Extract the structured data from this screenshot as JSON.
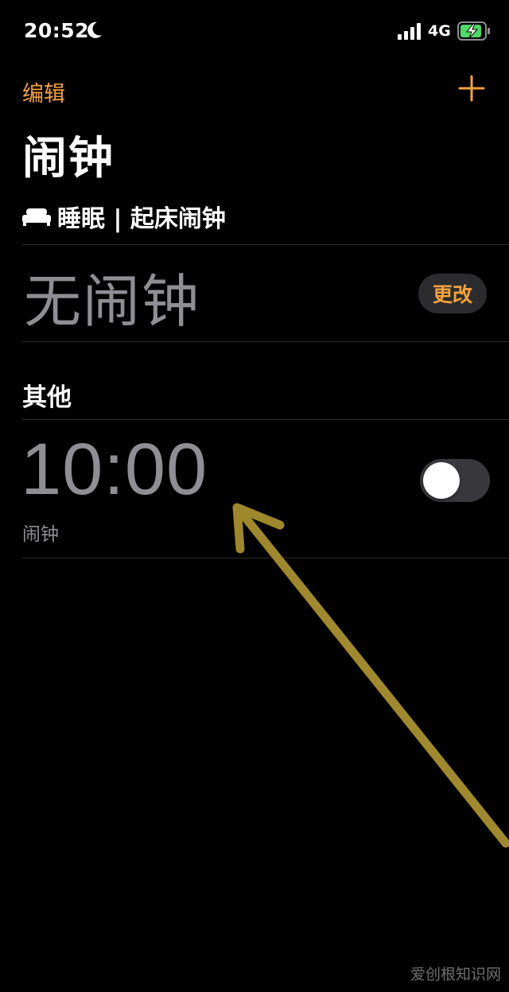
{
  "status_bar": {
    "time": "20:52",
    "network": "4G",
    "icons": [
      "moon-icon",
      "signal-icon",
      "battery-charging-icon"
    ]
  },
  "nav": {
    "edit_label": "编辑",
    "add_icon": "plus-icon"
  },
  "title": "闹钟",
  "sleep": {
    "icon": "bed-icon",
    "header": "睡眠 | 起床闹钟",
    "no_alarm": "无闹钟",
    "change_label": "更改"
  },
  "other": {
    "header": "其他",
    "alarms": [
      {
        "time": "10:00",
        "label": "闹钟",
        "enabled": false
      }
    ]
  },
  "watermark": "爱创根知识网",
  "colors": {
    "accent": "#f4a23b",
    "background": "#000000",
    "secondary_text": "#8e8e93",
    "annotation_arrow": "#a8902e"
  }
}
